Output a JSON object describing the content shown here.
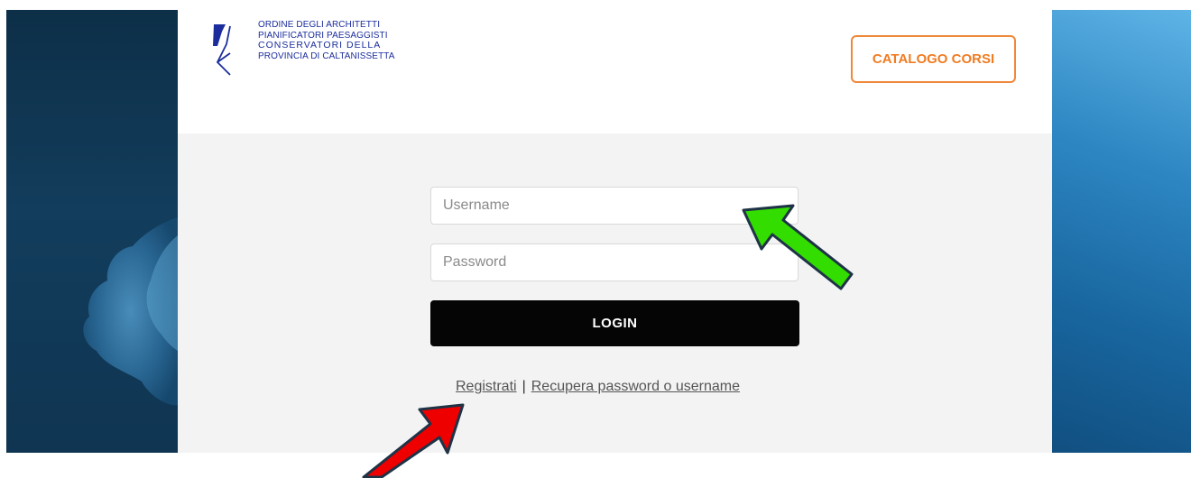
{
  "brand": {
    "logo_lines": [
      "ORDINE DEGLI ARCHITETTI",
      "PIANIFICATORI PAESAGGISTI",
      "CONSERVATORI DELLA",
      "PROVINCIA DI CALTANISSETTA"
    ],
    "color": "#1b2d9c"
  },
  "header": {
    "catalog_button": "CATALOGO CORSI",
    "accent_color": "#f0883a"
  },
  "login_form": {
    "username_placeholder": "Username",
    "username_value": "",
    "password_placeholder": "Password",
    "password_value": "",
    "login_button": "LOGIN",
    "register_link": "Registrati",
    "separator": "|",
    "recover_link": "Recupera password o username"
  },
  "annotations": {
    "arrow_green": {
      "color": "#33dd00",
      "target": "username-input",
      "icon": "green-arrow-icon"
    },
    "arrow_red": {
      "color": "#ee0000",
      "target": "register-link",
      "icon": "red-arrow-icon"
    }
  }
}
